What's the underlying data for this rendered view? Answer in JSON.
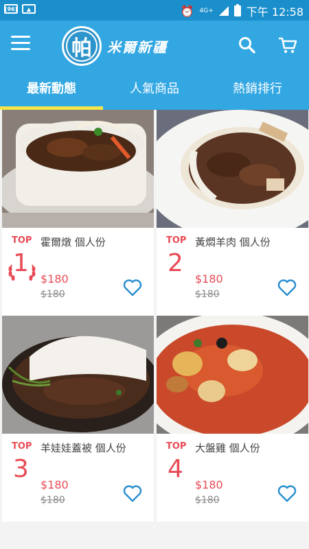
{
  "status_bar": {
    "left_icons": [
      "hd-badge-icon",
      "image-icon"
    ],
    "hd_text": "(96)",
    "network": "4G+",
    "time": "下午 12:58"
  },
  "app_bar": {
    "logo_glyph": "帕",
    "logo_text": "米爾新疆",
    "colors": {
      "bar": "#33a7e2",
      "status": "#1a8fcb",
      "accent": "#e84a55",
      "indicator": "#f4e64a"
    }
  },
  "tabs": [
    {
      "label": "最新動態",
      "active": true
    },
    {
      "label": "人氣商品",
      "active": false
    },
    {
      "label": "熱銷排行",
      "active": false
    }
  ],
  "products": [
    {
      "top": "TOP",
      "rank": "1",
      "title": "霍爾燉 個人份",
      "price": "$180",
      "old_price": "$180",
      "badge": "laurel-icon"
    },
    {
      "top": "TOP",
      "rank": "2",
      "title": "黃燜羊肉 個人份",
      "price": "$180",
      "old_price": "$180"
    },
    {
      "top": "TOP",
      "rank": "3",
      "title": "羊娃娃蓋被 個人份",
      "price": "$180",
      "old_price": "$180"
    },
    {
      "top": "TOP",
      "rank": "4",
      "title": "大盤雞 個人份",
      "price": "$180",
      "old_price": "$180"
    }
  ]
}
